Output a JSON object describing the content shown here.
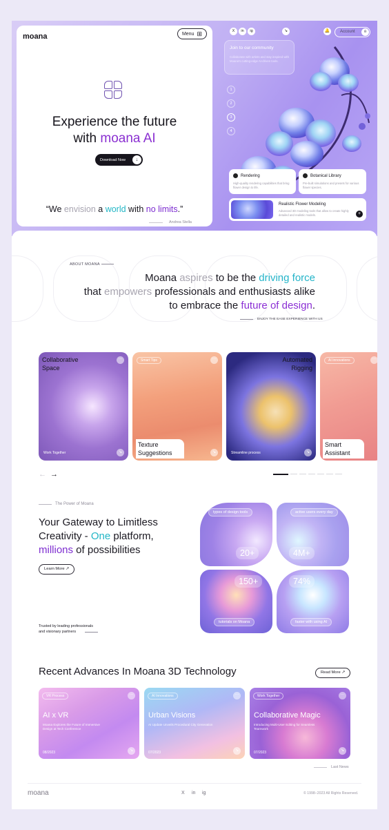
{
  "hero": {
    "logo": "moana",
    "menu_label": "Menu",
    "title_line1": "Experience the future",
    "title_line2_prefix": "with ",
    "title_line2_accent": "moana AI",
    "download_label": "Download Now",
    "quote": {
      "q_open": "“We ",
      "envision": "envision",
      "a": " a ",
      "world": "world",
      "with": " with ",
      "limits": "no limits",
      "q_close": ".”"
    },
    "quote_author": "Andrea Stella"
  },
  "topbar": {
    "social": [
      "X",
      "in",
      "ig"
    ],
    "account_label": "Account"
  },
  "community": {
    "title": "Join to our community",
    "desc": "Collaborate with artists and stay inspired with Moana's cutting-edge AI-driven tools."
  },
  "steps": [
    "1",
    "2",
    "3",
    "4"
  ],
  "mini_cards": [
    {
      "title": "Rendering",
      "desc": "High-quality rendering capabilities that bring flower design to life."
    },
    {
      "title": "Botanical Library",
      "desc": "Pre-built simulations and presets for various flower species."
    },
    {
      "title": "Realistic Flower Modeling",
      "desc": "Advanced 3D modeling tools that allow to create highly detailed and realistic models."
    }
  ],
  "about": {
    "label": "ABOUT MOANA",
    "l1_a": "Moana ",
    "l1_g": "aspires",
    "l1_b": " to be the ",
    "l1_c": "driving force",
    "l2_a": "that ",
    "l2_g": "empowers",
    "l2_b": " professionals and enthusiasts alike",
    "l3_a": "to embrace the ",
    "l3_p": "future of design",
    "l3_b": ".",
    "enjoy": "ENJOY THE EASE EXPERIENCE WITH US"
  },
  "features": [
    {
      "title": "Collaborative Space",
      "tag": "",
      "bottom": "Work Together"
    },
    {
      "title": "Texture Suggestions",
      "tag": "Smart Tips",
      "bottom": ""
    },
    {
      "title": "Automated Rigging",
      "tag": "",
      "bottom": "Streamline process"
    },
    {
      "title": "Smart Assistant",
      "tag": "AI Innovations",
      "bottom": ""
    }
  ],
  "carousel": {
    "prev": "←",
    "next": "→",
    "pages": 7,
    "active_page": 1
  },
  "gateway": {
    "label": "The Power of Moana",
    "t1": "Your Gateway to Limitless",
    "t2_a": "Creativity - ",
    "t2_c": "One",
    "t2_b": " platform,",
    "t3_p": "millions",
    "t3_b": " of possibilities",
    "learn_more": "Learn More",
    "trusted_1": "Trusted by leading professionals",
    "trusted_2": "and visionary partners"
  },
  "stats": [
    {
      "label": "types of design tools",
      "value": "20+"
    },
    {
      "label": "active users every day",
      "value": "4M+"
    },
    {
      "label": "tutorials on Moana",
      "value": "150+"
    },
    {
      "label": "faster with using AI",
      "value": "74%"
    }
  ],
  "recent": {
    "title": "Recent Advances In Moana 3D Technology",
    "read_more": "Read More",
    "cards": [
      {
        "tag": "VR Process",
        "title": "AI x VR",
        "desc": "Moana Explores the Future of Immersive Design at Tech Conference",
        "date": "08/2023"
      },
      {
        "tag": "AI Innovations",
        "title": "Urban Visions",
        "desc": "AI Update Unveils Procedural City Generation",
        "date": "07/2023"
      },
      {
        "tag": "Work Together",
        "title": "Collaborative Magic",
        "desc": "Introducing Multi-User Editing for Seamless Teamwork",
        "date": "07/2023"
      }
    ],
    "last_news": "Last News"
  },
  "footer": {
    "logo": "moana",
    "social": [
      "X",
      "in",
      "ig"
    ],
    "copyright": "© 1998–2023 All Rights Reserved."
  },
  "colors": {
    "accent_purple": "#8a2fd1",
    "accent_cyan": "#22b6c6",
    "hero_bg": "#b9a8f5"
  }
}
